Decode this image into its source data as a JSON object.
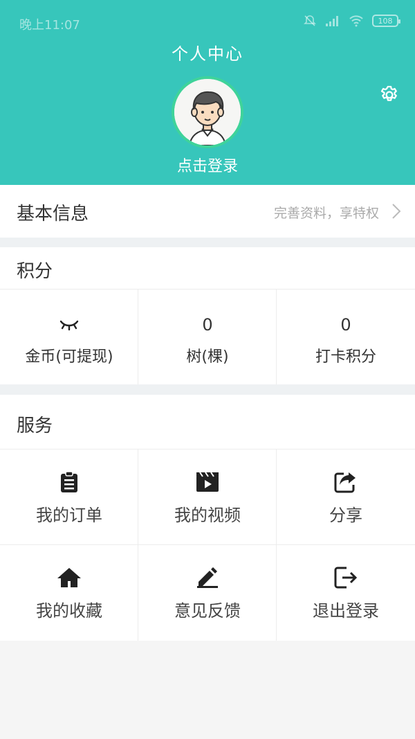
{
  "status": {
    "time": "晚上11:07",
    "battery": "108"
  },
  "header": {
    "title": "个人中心",
    "login": "点击登录"
  },
  "basic": {
    "label": "基本信息",
    "hint": "完善资料，享特权"
  },
  "points": {
    "title": "积分",
    "items": [
      {
        "value": "",
        "label": "金币(可提现)",
        "icon": "hidden-eye-icon"
      },
      {
        "value": "0",
        "label": "树(棵)"
      },
      {
        "value": "0",
        "label": "打卡积分"
      }
    ]
  },
  "services": {
    "title": "服务",
    "items": [
      {
        "label": "我的订单",
        "icon": "clipboard-icon"
      },
      {
        "label": "我的视频",
        "icon": "video-icon"
      },
      {
        "label": "分享",
        "icon": "share-icon"
      },
      {
        "label": "我的收藏",
        "icon": "home-icon"
      },
      {
        "label": "意见反馈",
        "icon": "edit-icon"
      },
      {
        "label": "退出登录",
        "icon": "logout-icon"
      }
    ]
  },
  "colors": {
    "brand": "#37c6bb",
    "avatar_ring": "#3fd39a"
  }
}
